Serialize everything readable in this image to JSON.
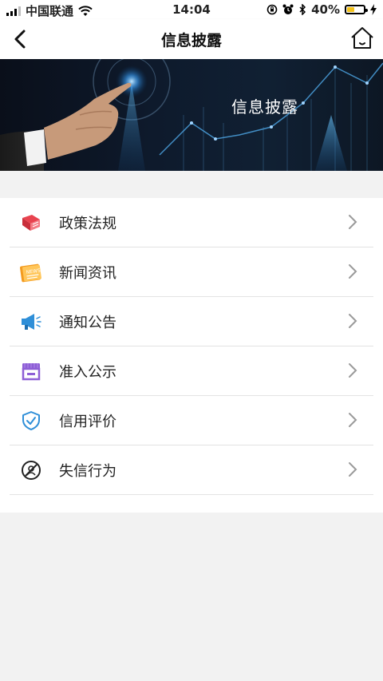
{
  "status_bar": {
    "carrier": "中国联通",
    "time": "14:04",
    "battery_percent": "40%",
    "battery_level": 0.4
  },
  "nav": {
    "title": "信息披露"
  },
  "banner": {
    "title": "信息披露"
  },
  "menu": {
    "items": [
      {
        "label": "政策法规",
        "icon": "book-icon",
        "color": "#e8434f"
      },
      {
        "label": "新闻资讯",
        "icon": "newspaper-icon",
        "color": "#f39b1f"
      },
      {
        "label": "通知公告",
        "icon": "megaphone-icon",
        "color": "#2f8fd8"
      },
      {
        "label": "准入公示",
        "icon": "storefront-icon",
        "color": "#8e5fd6"
      },
      {
        "label": "信用评价",
        "icon": "shield-check-icon",
        "color": "#2f8fd8"
      },
      {
        "label": "失信行为",
        "icon": "prohibited-icon",
        "color": "#222222"
      }
    ]
  }
}
